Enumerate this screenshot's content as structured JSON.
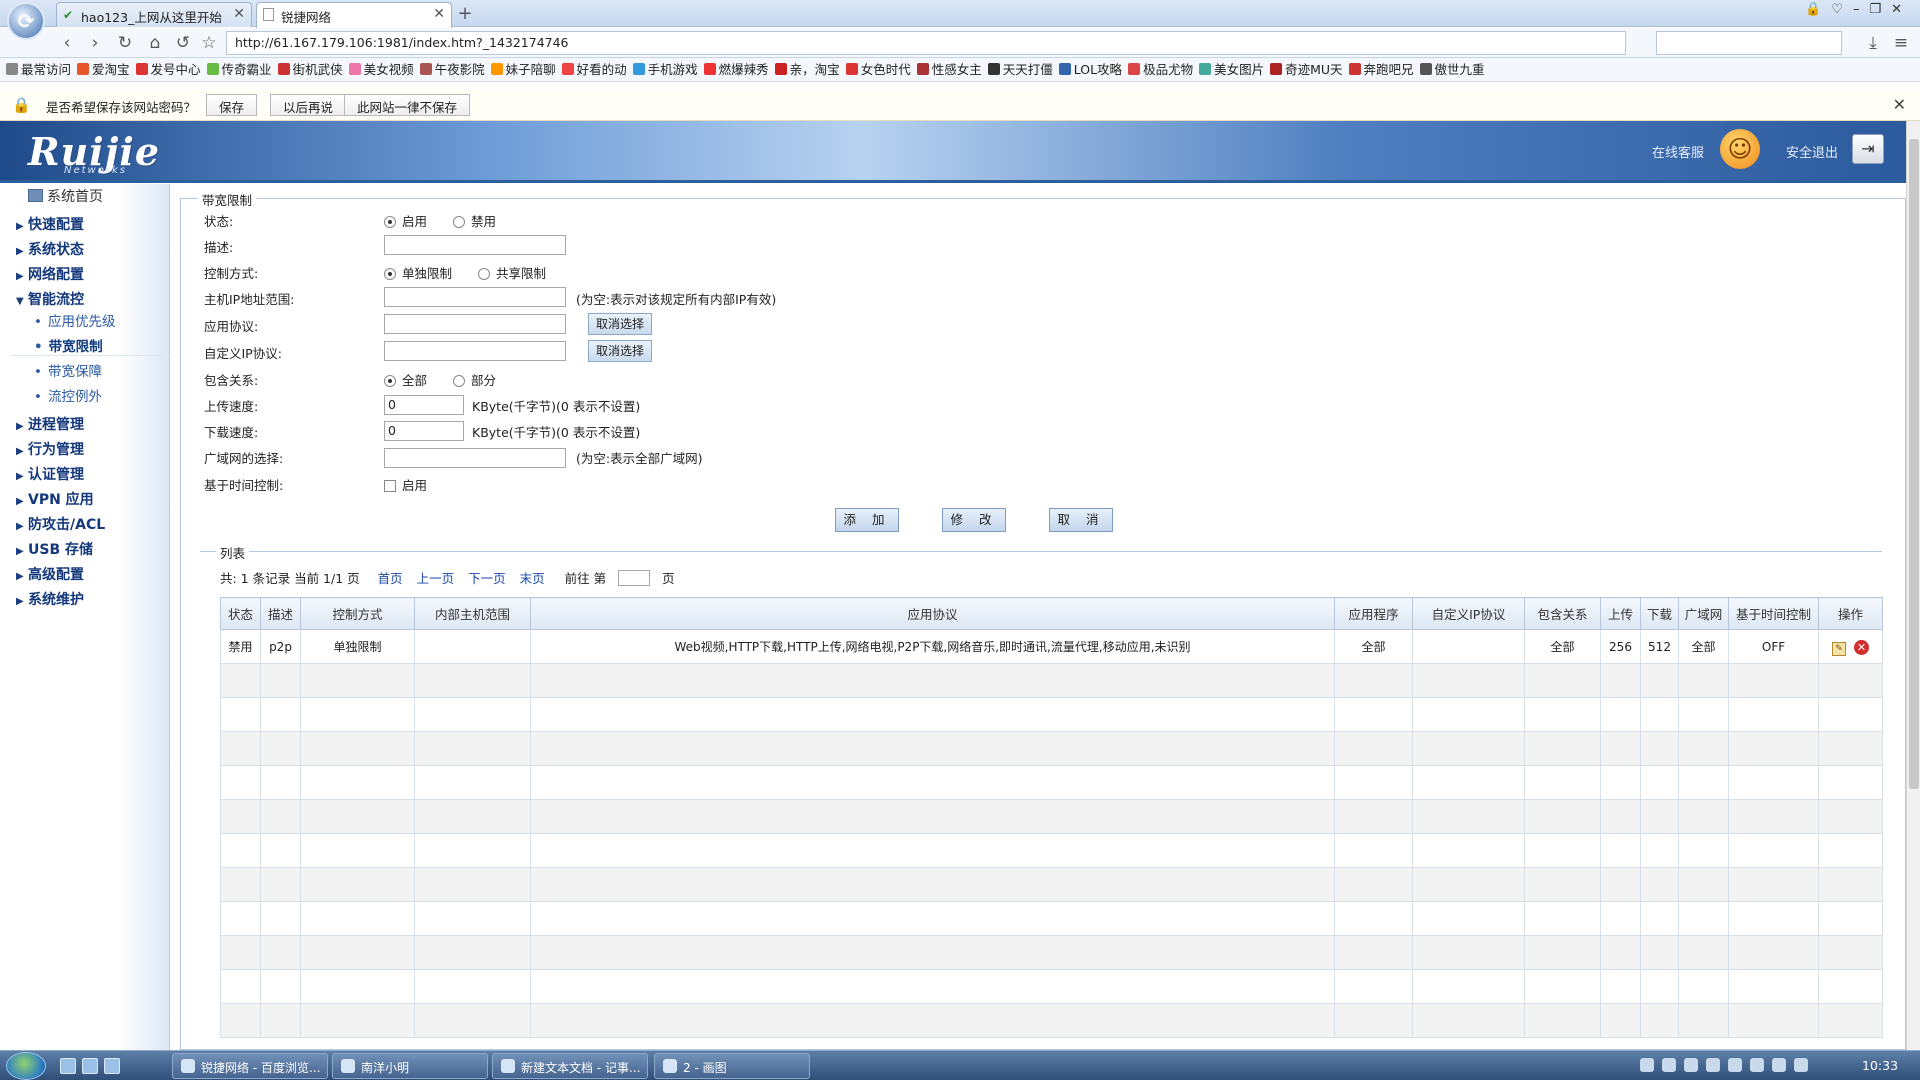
{
  "browser": {
    "tabs": [
      {
        "title": "hao123_上网从这里开始",
        "active": false
      },
      {
        "title": "锐捷网络",
        "active": true
      }
    ],
    "url": "http://61.167.179.106:1981/index.htm?_1432174746",
    "bookmarks": [
      "最常访问",
      "爱淘宝",
      "发号中心",
      "传奇霸业",
      "街机武侠",
      "美女视频",
      "午夜影院",
      "妹子陪聊",
      "好看的动",
      "手机游戏",
      "燃爆辣秀",
      "亲，淘宝",
      "女色时代",
      "性感女主",
      "天天打僵",
      "LOL攻略",
      "极品尤物",
      "美女图片",
      "奇迹MU天",
      "奔跑吧兄",
      "傲世九重"
    ],
    "password_bar": {
      "question": "是否希望保存该网站密码？",
      "save": "保存",
      "later": "以后再说",
      "never": "此网站一律不保存"
    }
  },
  "header": {
    "logo": "Ruijie",
    "logo_sub": "Networks",
    "online_service": "在线客服",
    "safe_exit": "安全退出"
  },
  "sidebar": {
    "home": "系统首页",
    "items": [
      "快速配置",
      "系统状态",
      "网络配置",
      "智能流控"
    ],
    "sub_items": [
      "应用优先级",
      "带宽限制",
      "带宽保障",
      "流控例外"
    ],
    "items_after": [
      "进程管理",
      "行为管理",
      "认证管理",
      "VPN 应用",
      "防攻击/ACL",
      "USB 存储",
      "高级配置",
      "系统维护"
    ]
  },
  "form": {
    "legend": "带宽限制",
    "status_label": "状态:",
    "status_enable": "启用",
    "status_disable": "禁用",
    "desc_label": "描述:",
    "control_label": "控制方式:",
    "control_single": "单独限制",
    "control_shared": "共享限制",
    "ip_range_label": "主机IP地址范围:",
    "ip_range_hint": "(为空:表示对该规定所有内部IP有效)",
    "app_proto_label": "应用协议:",
    "custom_ip_label": "自定义IP协议:",
    "cancel_select": "取消选择",
    "contain_label": "包含关系:",
    "contain_all": "全部",
    "contain_part": "部分",
    "upload_label": "上传速度:",
    "upload_value": "0",
    "download_label": "下载速度:",
    "download_value": "0",
    "speed_hint": "KByte(千字节)(0 表示不设置)",
    "wan_label": "广域网的选择:",
    "wan_hint": "(为空:表示全部广域网)",
    "time_label": "基于时间控制:",
    "time_enable": "启用",
    "add": "添 加",
    "modify": "修 改",
    "cancel": "取 消"
  },
  "list": {
    "legend": "列表",
    "summary": "共: 1 条记录 当前 1/1 页",
    "first": "首页",
    "prev": "上一页",
    "next": "下一页",
    "last": "末页",
    "goto": "前往 第",
    "page_unit": "页",
    "columns": [
      "状态",
      "描述",
      "控制方式",
      "内部主机范围",
      "应用协议",
      "应用程序",
      "自定义IP协议",
      "包含关系",
      "上传",
      "下载",
      "广域网",
      "基于时间控制",
      "操作"
    ],
    "rows": [
      [
        "禁用",
        "p2p",
        "单独限制",
        "",
        "Web视频,HTTP下载,HTTP上传,网络电视,P2P下载,网络音乐,即时通讯,流量代理,移动应用,未识别",
        "全部",
        "",
        "全部",
        "256",
        "512",
        "全部",
        "OFF"
      ]
    ]
  },
  "taskbar": {
    "tasks": [
      "锐捷网络 - 百度浏览...",
      "南洋小明",
      "新建文本文档 - 记事...",
      "2 - 画图"
    ],
    "clock": "10:33"
  }
}
